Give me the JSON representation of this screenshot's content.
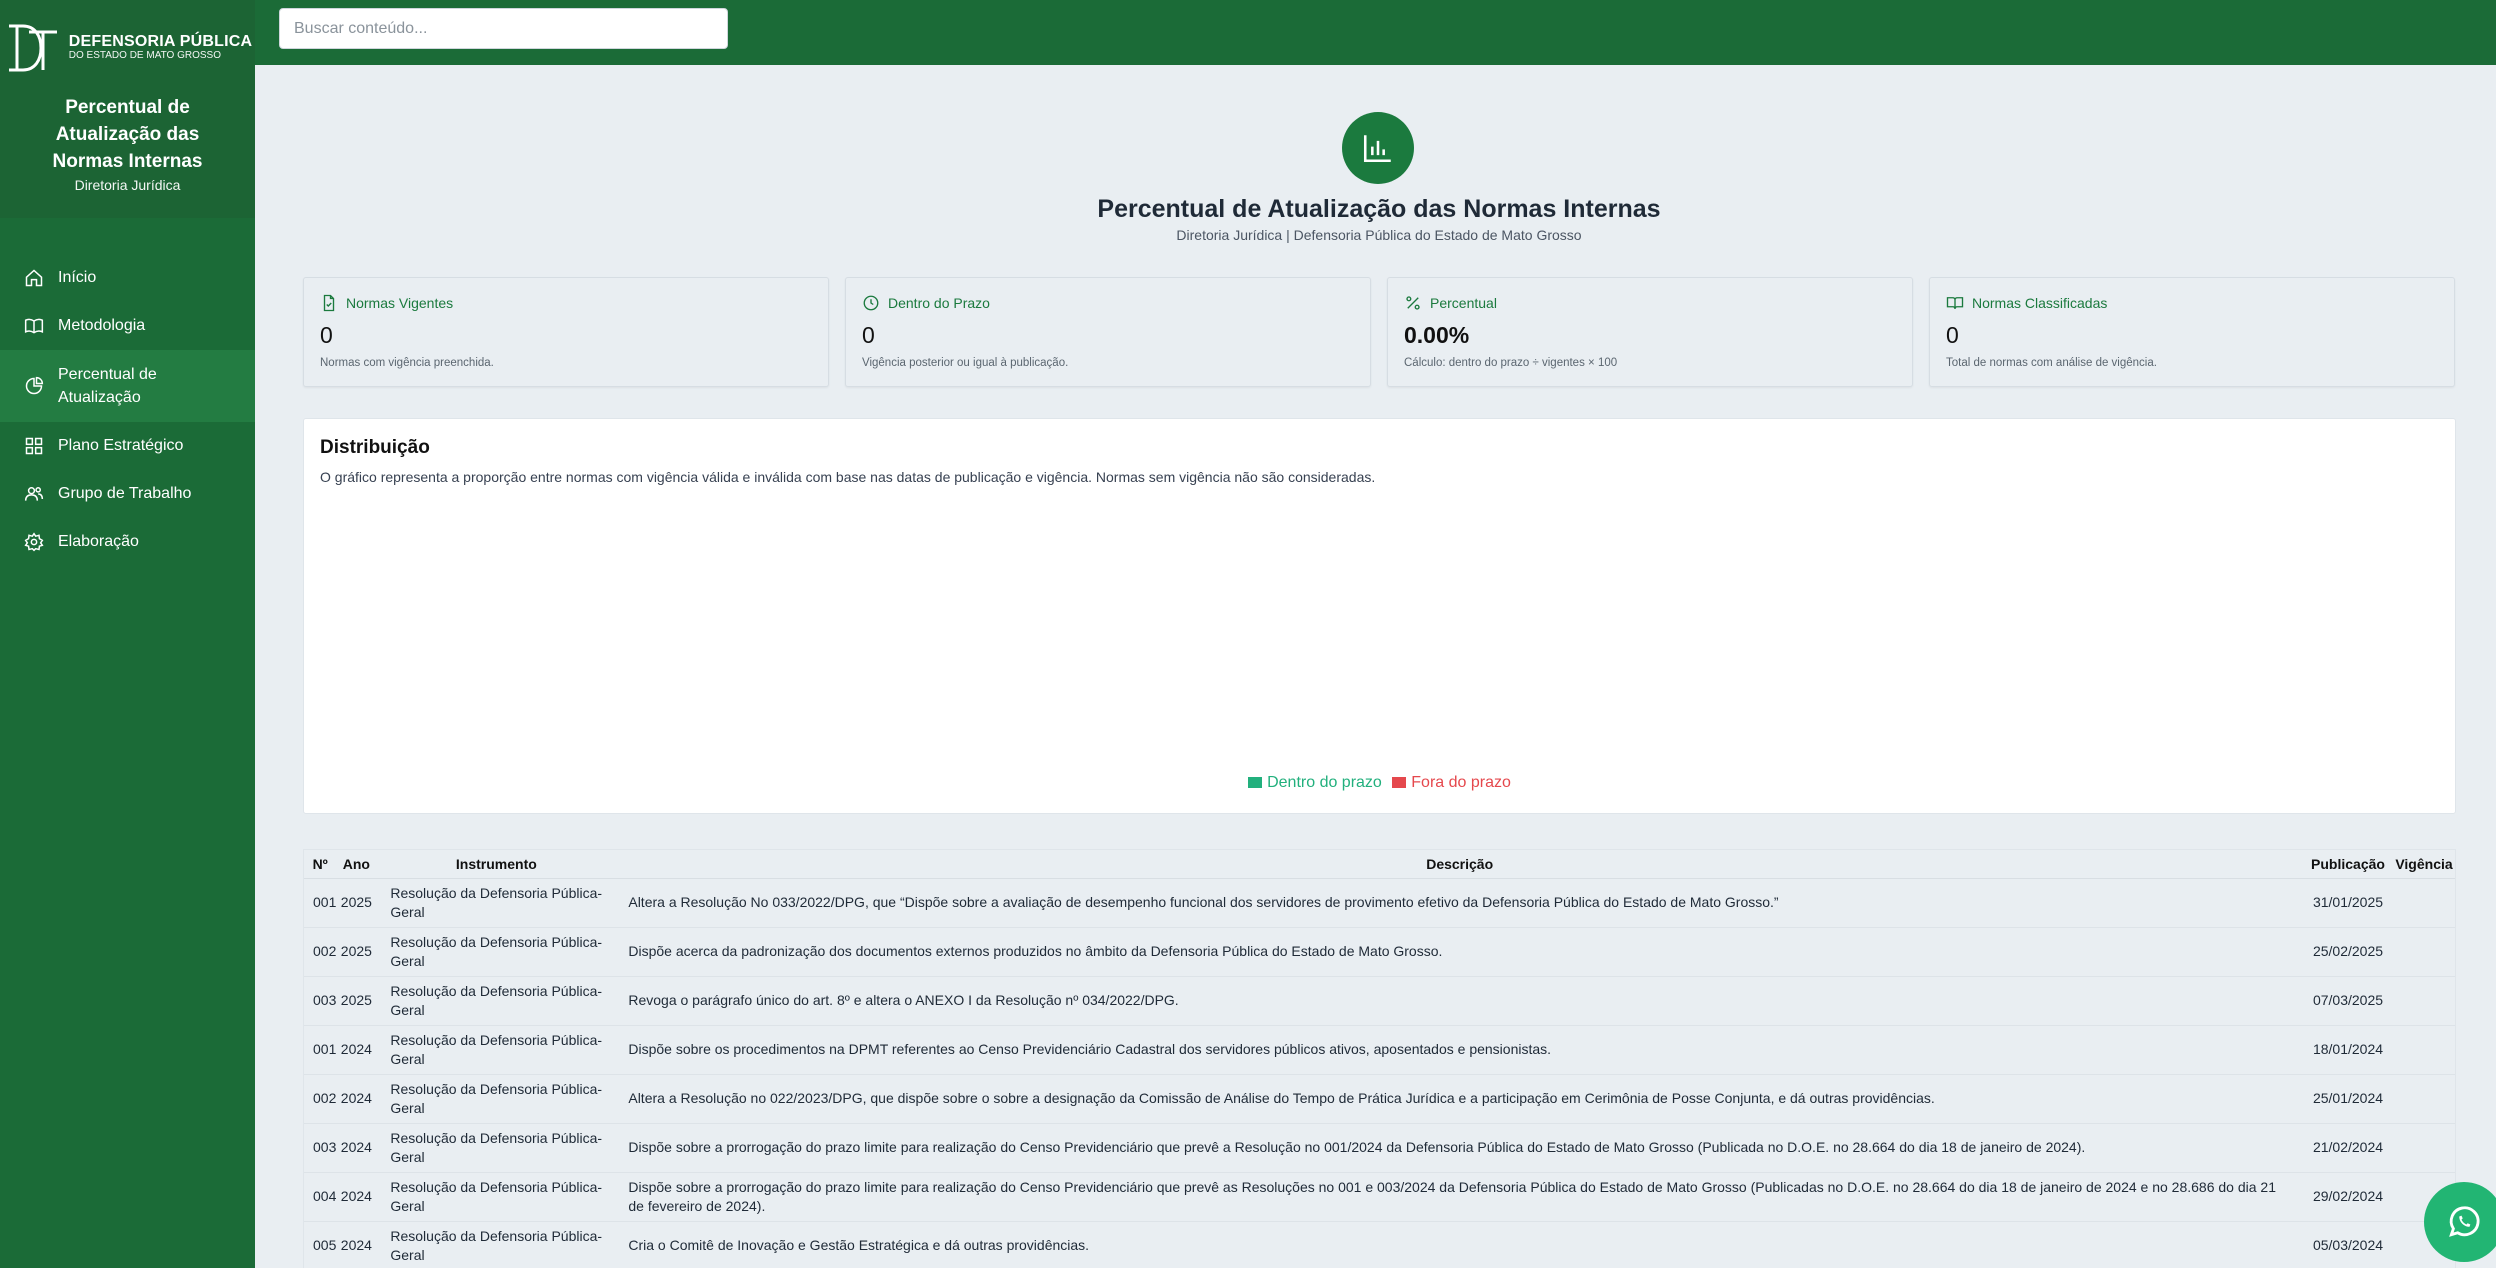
{
  "sidebar": {
    "logo_line1": "DEFENSORIA PÚBLICA",
    "logo_line2": "DO ESTADO DE MATO GROSSO",
    "title": "Percentual de Atualização das Normas Internas",
    "subtitle": "Diretoria Jurídica",
    "items": [
      {
        "label": "Início",
        "icon": "home-icon"
      },
      {
        "label": "Metodologia",
        "icon": "book-icon"
      },
      {
        "label": "Percentual de Atualização",
        "icon": "pie-chart-icon",
        "active": true
      },
      {
        "label": "Plano Estratégico",
        "icon": "grid-icon"
      },
      {
        "label": "Grupo de Trabalho",
        "icon": "users-icon"
      },
      {
        "label": "Elaboração",
        "icon": "gear-icon"
      }
    ]
  },
  "search": {
    "placeholder": "Buscar conteúdo..."
  },
  "hero": {
    "title": "Percentual de Atualização das Normas Internas",
    "subtitle": "Diretoria Jurídica | Defensoria Pública do Estado de Mato Grosso"
  },
  "cards": [
    {
      "label": "Normas Vigentes",
      "value": "0",
      "note": "Normas com vigência preenchida.",
      "icon": "file-check-icon"
    },
    {
      "label": "Dentro do Prazo",
      "value": "0",
      "note": "Vigência posterior ou igual à publicação.",
      "icon": "clock-icon"
    },
    {
      "label": "Percentual",
      "value": "0.00%",
      "note": "Cálculo: dentro do prazo ÷ vigentes × 100",
      "icon": "percent-icon"
    },
    {
      "label": "Normas Classificadas",
      "value": "0",
      "note": "Total de normas com análise de vigência.",
      "icon": "open-book-icon"
    }
  ],
  "distribution": {
    "title": "Distribuição",
    "text": "O gráfico representa a proporção entre normas com vigência válida e inválida com base nas datas de publicação e vigência. Normas sem vigência não são consideradas.",
    "legend": [
      {
        "label": "Dentro do prazo",
        "color": "#22b07d"
      },
      {
        "label": "Fora do prazo",
        "color": "#e5484d"
      }
    ]
  },
  "table": {
    "headers": [
      "Nº",
      "Ano",
      "Instrumento",
      "Descrição",
      "Publicação",
      "Vigência"
    ],
    "rows": [
      {
        "n": "001",
        "ano": "2025",
        "instrumento": "Resolução da Defensoria Pública-Geral",
        "descricao": "Altera a Resolução No 033/2022/DPG, que “Dispõe sobre a avaliação de desempenho funcional dos servidores de provimento efetivo da Defensoria Pública do Estado de Mato Grosso.”",
        "publicacao": "31/01/2025",
        "vigencia": ""
      },
      {
        "n": "002",
        "ano": "2025",
        "instrumento": "Resolução da Defensoria Pública-Geral",
        "descricao": "Dispõe acerca da padronização dos documentos externos produzidos no âmbito da Defensoria Pública do Estado de Mato Grosso.",
        "publicacao": "25/02/2025",
        "vigencia": ""
      },
      {
        "n": "003",
        "ano": "2025",
        "instrumento": "Resolução da Defensoria Pública-Geral",
        "descricao": "Revoga o parágrafo único do art. 8º e altera o ANEXO I da Resolução nº 034/2022/DPG.",
        "publicacao": "07/03/2025",
        "vigencia": ""
      },
      {
        "n": "001",
        "ano": "2024",
        "instrumento": "Resolução da Defensoria Pública-Geral",
        "descricao": "Dispõe sobre os procedimentos na DPMT referentes ao Censo Previdenciário Cadastral dos servidores públicos ativos, aposentados e pensionistas.",
        "publicacao": "18/01/2024",
        "vigencia": ""
      },
      {
        "n": "002",
        "ano": "2024",
        "instrumento": "Resolução da Defensoria Pública-Geral",
        "descricao": "Altera a Resolução no 022/2023/DPG, que dispõe sobre o sobre a designação da Comissão de Análise do Tempo de Prática Jurídica e a participação em Cerimônia de Posse Conjunta, e dá outras providências.",
        "publicacao": "25/01/2024",
        "vigencia": ""
      },
      {
        "n": "003",
        "ano": "2024",
        "instrumento": "Resolução da Defensoria Pública-Geral",
        "descricao": "Dispõe sobre a prorrogação do prazo limite para realização do Censo Previdenciário que prevê a Resolução no 001/2024 da Defensoria Pública do Estado de Mato Grosso (Publicada no D.O.E. no 28.664 do dia 18 de janeiro de 2024).",
        "publicacao": "21/02/2024",
        "vigencia": ""
      },
      {
        "n": "004",
        "ano": "2024",
        "instrumento": "Resolução da Defensoria Pública-Geral",
        "descricao": "Dispõe sobre a prorrogação do prazo limite para realização do Censo Previdenciário que prevê as Resoluções no 001 e 003/2024 da Defensoria Pública do Estado de Mato Grosso (Publicadas no D.O.E. no 28.664 do dia 18 de janeiro de 2024 e no 28.686 do dia 21 de fevereiro de 2024).",
        "publicacao": "29/02/2024",
        "vigencia": ""
      },
      {
        "n": "005",
        "ano": "2024",
        "instrumento": "Resolução da Defensoria Pública-Geral",
        "descricao": "Cria o Comitê de Inovação e Gestão Estratégica e dá outras providências.",
        "publicacao": "05/03/2024",
        "vigencia": ""
      }
    ]
  },
  "whatsapp": {
    "icon": "whatsapp-icon"
  }
}
